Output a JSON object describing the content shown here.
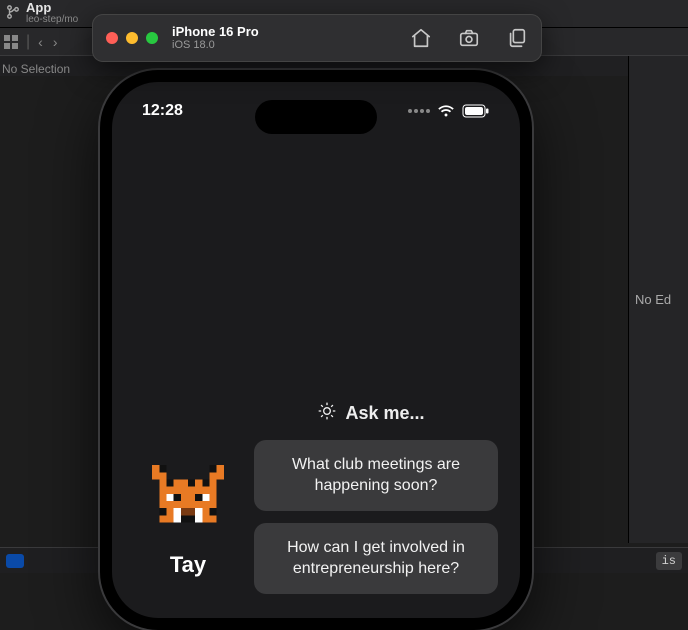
{
  "xcode": {
    "top_title": "App",
    "top_sub": "leo-step/mo",
    "no_selection": "No Selection",
    "right_pane": "No Ed",
    "is_badge": "is"
  },
  "simulator": {
    "title": "iPhone 16 Pro",
    "subtitle": "iOS 18.0"
  },
  "phone": {
    "time": "12:28",
    "ask_label": "Ask me...",
    "avatar_name": "Tay",
    "suggestions": [
      "What club meetings are happening soon?",
      "How can I get involved in entrepreneurship here?"
    ]
  }
}
